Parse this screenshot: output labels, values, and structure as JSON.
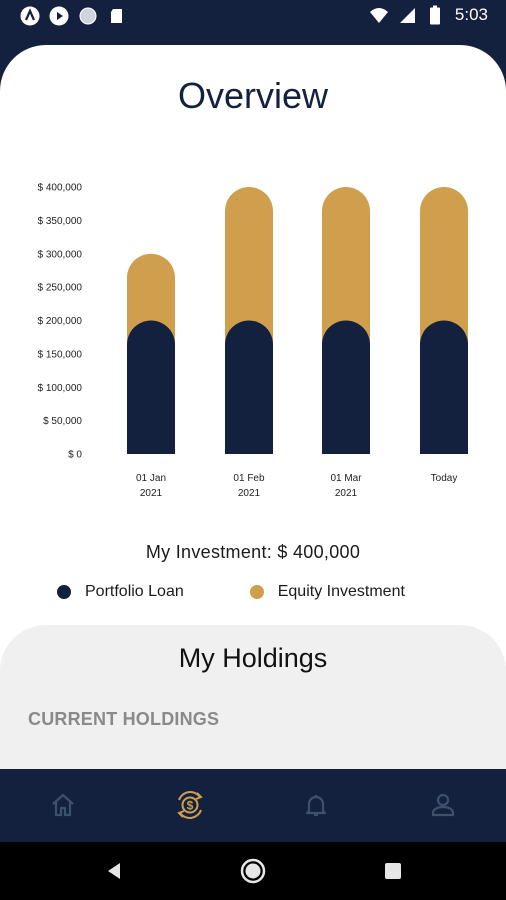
{
  "status_bar": {
    "time": "5:03",
    "icons": [
      "app-a-icon",
      "play-shield-icon",
      "circle-icon",
      "sd-card-icon",
      "wifi-icon",
      "signal-icon",
      "battery-icon"
    ]
  },
  "overview": {
    "title": "Overview"
  },
  "chart_data": {
    "type": "bar",
    "stacked": true,
    "categories": [
      "01 Jan\n2021",
      "01 Feb\n2021",
      "01 Mar\n2021",
      "Today"
    ],
    "series": [
      {
        "name": "Portfolio Loan",
        "color": "#13213f",
        "values": [
          200000,
          200000,
          200000,
          200000
        ]
      },
      {
        "name": "Equity Investment",
        "color": "#cf9f4e",
        "values": [
          100000,
          200000,
          200000,
          200000
        ]
      }
    ],
    "ylim": [
      0,
      400000
    ],
    "yticks": [
      "$ 0",
      "$ 50,000",
      "$ 100,000",
      "$ 150,000",
      "$ 200,000",
      "$ 250,000",
      "$ 300,000",
      "$ 350,000",
      "$ 400,000"
    ],
    "grid": false,
    "legend": "bottom"
  },
  "summary": {
    "investment_text": "My Investment: $ 400,000"
  },
  "legend": {
    "items": [
      {
        "label": "Portfolio Loan",
        "color": "#13213f"
      },
      {
        "label": "Equity Investment",
        "color": "#cf9f4e"
      }
    ]
  },
  "holdings": {
    "title": "My Holdings",
    "section_label": "CURRENT HOLDINGS"
  },
  "bottom_nav": {
    "items": [
      {
        "icon": "home-icon",
        "active": false
      },
      {
        "icon": "dollar-exchange-icon",
        "active": true
      },
      {
        "icon": "bell-icon",
        "active": false
      },
      {
        "icon": "profile-icon",
        "active": false
      }
    ],
    "active_color": "#cf9f4e",
    "inactive_color": "#3f4f6e"
  },
  "colors": {
    "navy": "#13213f",
    "gold": "#cf9f4e"
  }
}
